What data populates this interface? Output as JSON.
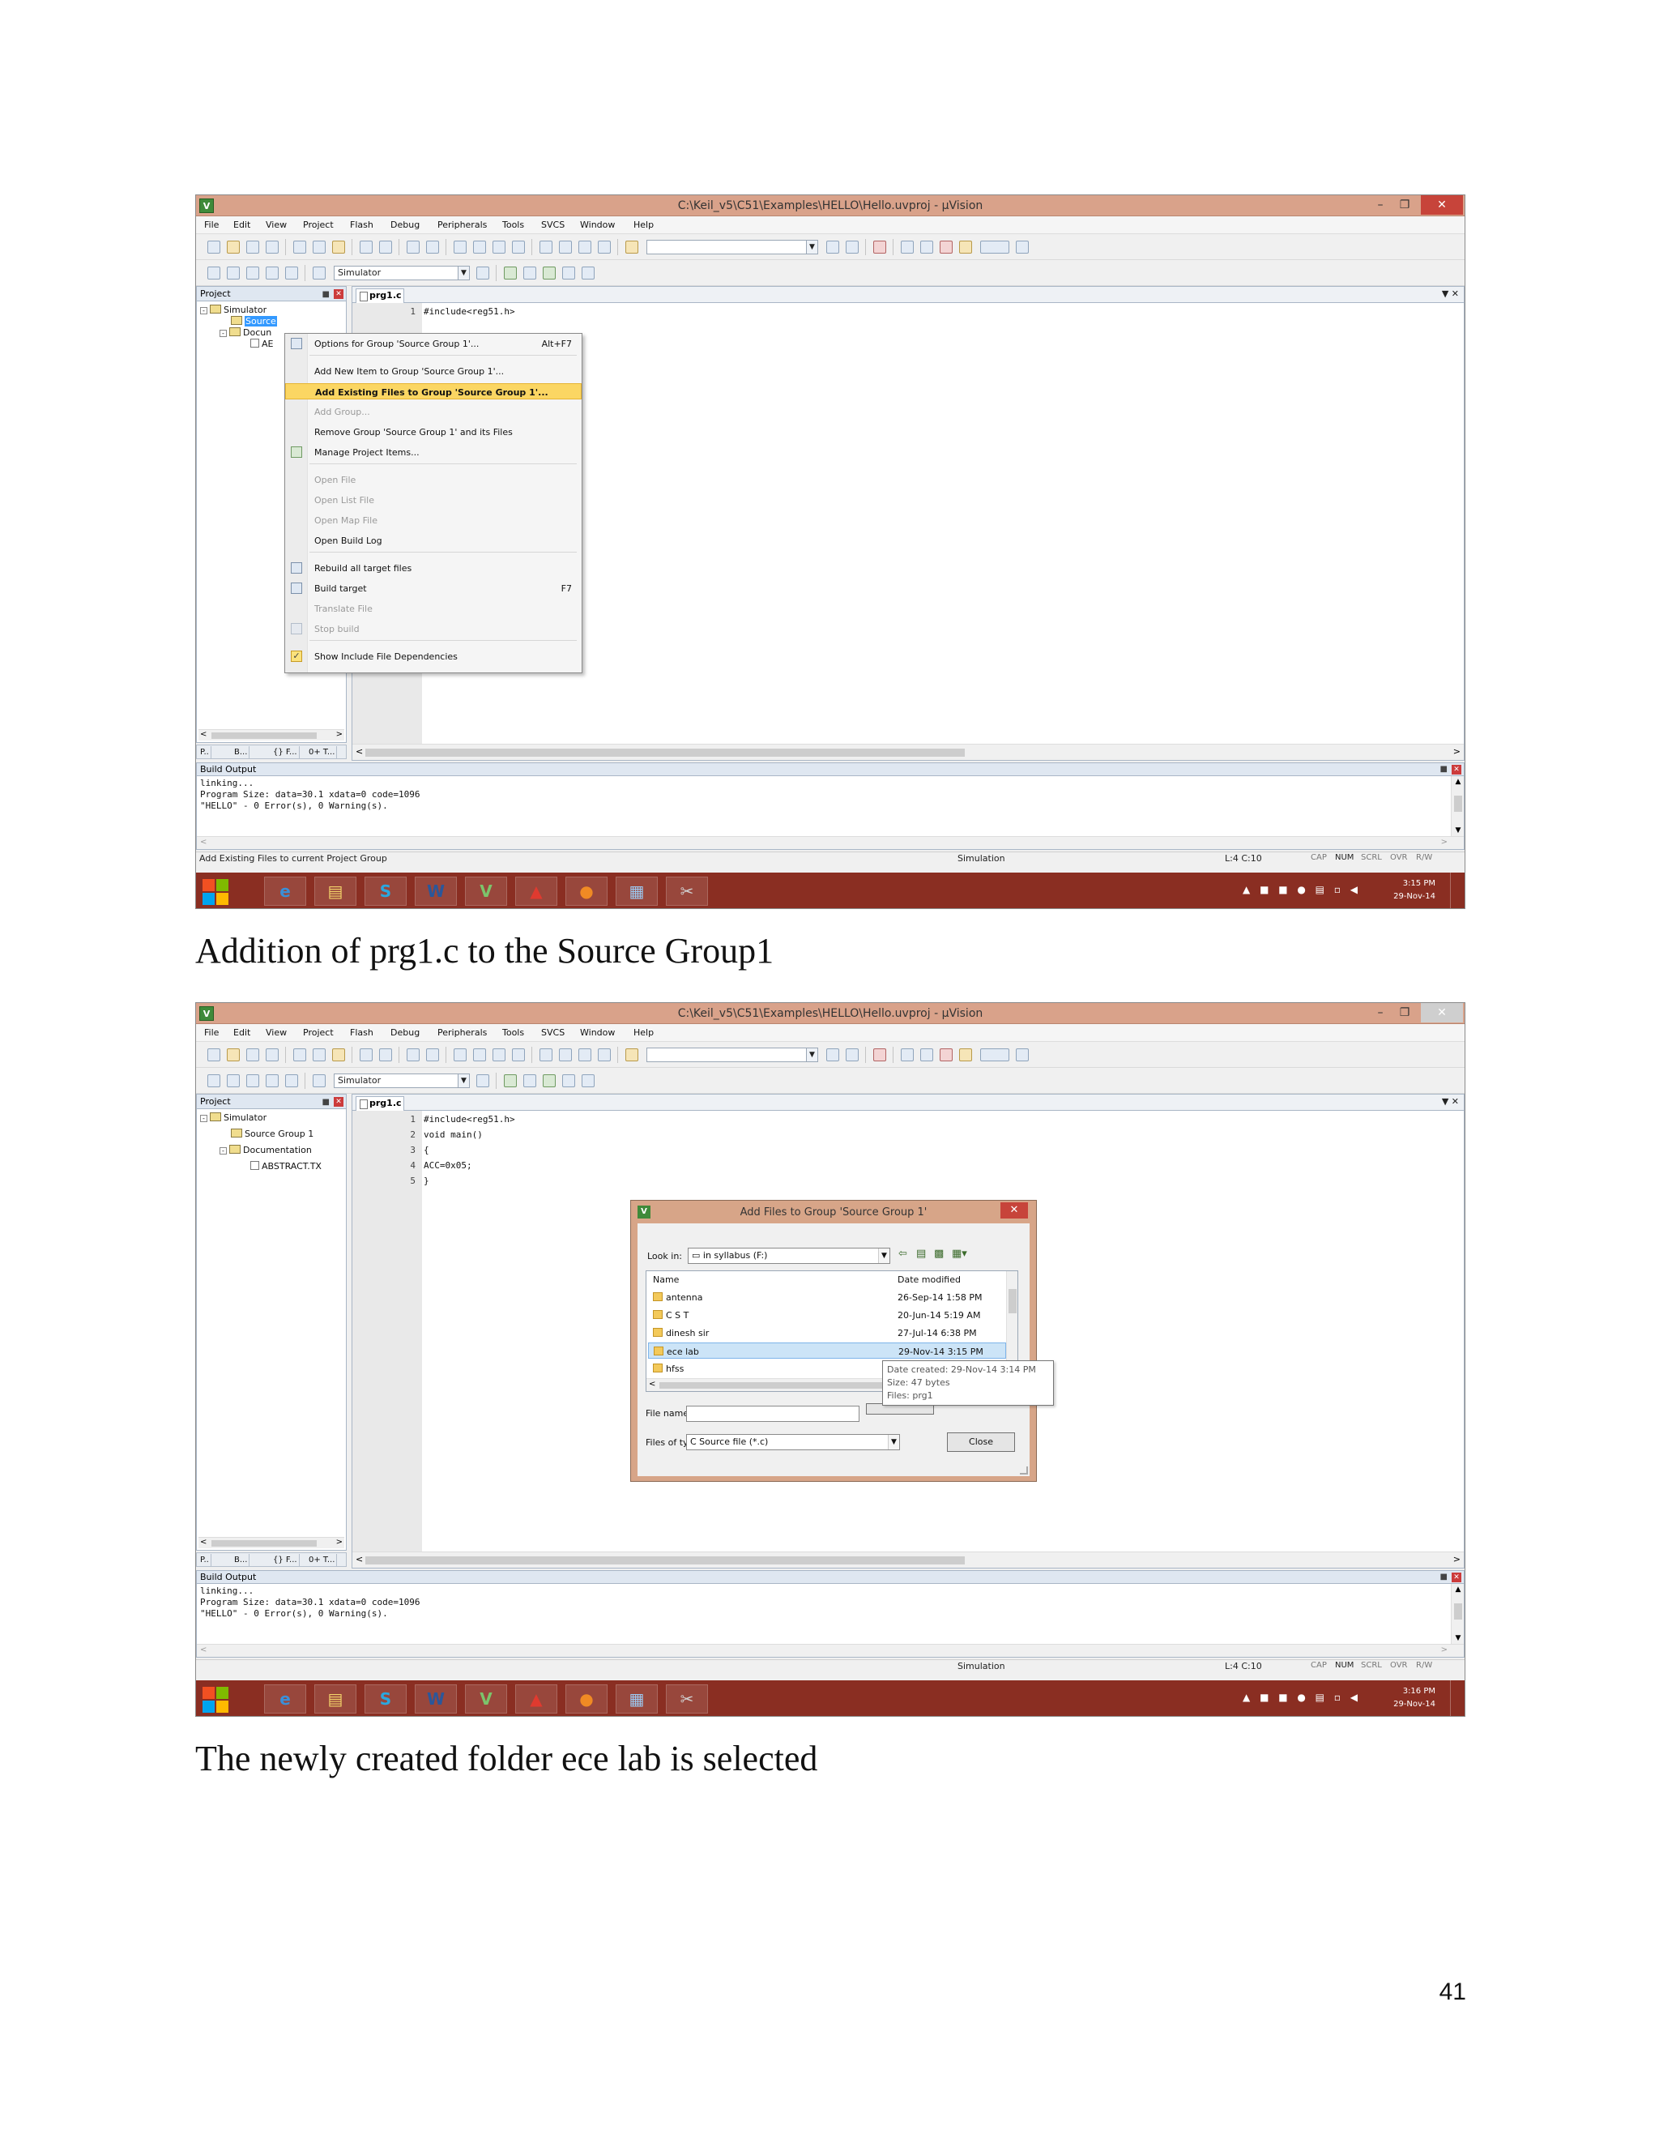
{
  "screenshot1": {
    "window_title": "C:\\Keil_v5\\C51\\Examples\\HELLO\\Hello.uvproj - µVision",
    "menu": [
      "File",
      "Edit",
      "View",
      "Project",
      "Flash",
      "Debug",
      "Peripherals",
      "Tools",
      "SVCS",
      "Window",
      "Help"
    ],
    "target_combo": "Simulator",
    "project_panel_title": "Project",
    "tree": {
      "root": "Simulator",
      "group": "Source",
      "docs": "Docun",
      "file": "AE"
    },
    "panel_tabs": [
      "P..",
      "B...",
      "{} F...",
      "0+ T..."
    ],
    "editor_tab": "prg1.c",
    "code_lines": [
      {
        "n": "1",
        "text": "#include<reg51.h>"
      }
    ],
    "context_menu": {
      "items": [
        {
          "label": "Options for Group 'Source Group 1'...",
          "shortcut": "Alt+F7"
        },
        {
          "label": "Add New  Item to Group 'Source Group 1'..."
        },
        {
          "label": "Add Existing Files to Group 'Source Group 1'..."
        },
        {
          "label": "Add Group..."
        },
        {
          "label": "Remove Group 'Source Group 1' and its Files"
        },
        {
          "label": "Manage Project Items..."
        },
        {
          "label": "Open File"
        },
        {
          "label": "Open List File"
        },
        {
          "label": "Open Map File"
        },
        {
          "label": "Open Build Log"
        },
        {
          "label": "Rebuild all target files"
        },
        {
          "label": "Build target",
          "shortcut": "F7"
        },
        {
          "label": "Translate File"
        },
        {
          "label": "Stop build"
        },
        {
          "label": "Show Include File Dependencies"
        }
      ]
    },
    "build_output": {
      "title": "Build Output",
      "lines": [
        "linking...",
        "Program Size: data=30.1 xdata=0 code=1096",
        "\"HELLO\" - 0 Error(s), 0 Warning(s)."
      ]
    },
    "status": {
      "message": "Add Existing Files to current Project Group",
      "mode": "Simulation",
      "position": "L:4 C:10",
      "keys": [
        "CAP",
        "NUM",
        "SCRL",
        "OVR",
        "R/W"
      ]
    },
    "tray": {
      "time": "3:15 PM",
      "date": "29-Nov-14"
    }
  },
  "caption1": "Addition of prg1.c to the Source Group1",
  "screenshot2": {
    "window_title": "C:\\Keil_v5\\C51\\Examples\\HELLO\\Hello.uvproj - µVision",
    "menu": [
      "File",
      "Edit",
      "View",
      "Project",
      "Flash",
      "Debug",
      "Peripherals",
      "Tools",
      "SVCS",
      "Window",
      "Help"
    ],
    "target_combo": "Simulator",
    "project_panel_title": "Project",
    "tree": {
      "root": "Simulator",
      "group": "Source Group 1",
      "docs": "Documentation",
      "file": "ABSTRACT.TX"
    },
    "panel_tabs": [
      "P..",
      "B...",
      "{} F...",
      "0+ T..."
    ],
    "editor_tab": "prg1.c",
    "code_lines": [
      {
        "n": "1",
        "text": "#include<reg51.h>"
      },
      {
        "n": "2",
        "text": "void main()"
      },
      {
        "n": "3",
        "text": "{"
      },
      {
        "n": "4",
        "text": "ACC=0x05;"
      },
      {
        "n": "5",
        "text": "}"
      }
    ],
    "dialog": {
      "title": "Add Files to Group 'Source Group 1'",
      "look_in_label": "Look in:",
      "look_in_value": "in syllabus (F:)",
      "col_name": "Name",
      "col_date": "Date modified",
      "files": [
        {
          "name": "antenna",
          "date": "26-Sep-14 1:58 PM"
        },
        {
          "name": "C S T",
          "date": "20-Jun-14 5:19 AM"
        },
        {
          "name": "dinesh sir",
          "date": "27-Jul-14 6:38 PM"
        },
        {
          "name": "ece lab",
          "date": "29-Nov-14 3:15 PM"
        },
        {
          "name": "hfss",
          "date": ""
        }
      ],
      "tooltip": [
        "Date created: 29-Nov-14 3:14 PM",
        "Size: 47 bytes",
        "Files: prg1"
      ],
      "file_name_label": "File name:",
      "file_name_value": "",
      "file_type_label": "Files of type:",
      "file_type_value": "C Source file (*.c)",
      "close_button": "Close"
    },
    "build_output": {
      "title": "Build Output",
      "lines": [
        "linking...",
        "Program Size: data=30.1 xdata=0 code=1096",
        "\"HELLO\" - 0 Error(s), 0 Warning(s)."
      ]
    },
    "status": {
      "message": "",
      "mode": "Simulation",
      "position": "L:4 C:10",
      "keys": [
        "CAP",
        "NUM",
        "SCRL",
        "OVR",
        "R/W"
      ]
    },
    "tray": {
      "time": "3:16 PM",
      "date": "29-Nov-14"
    }
  },
  "caption2": "The newly created folder ece lab is selected",
  "page_number": "41",
  "colors": {
    "title_bar": "#d9a28a",
    "taskbar": "#8a2e22",
    "highlight": "#fbd663",
    "selection": "#3399ff"
  }
}
